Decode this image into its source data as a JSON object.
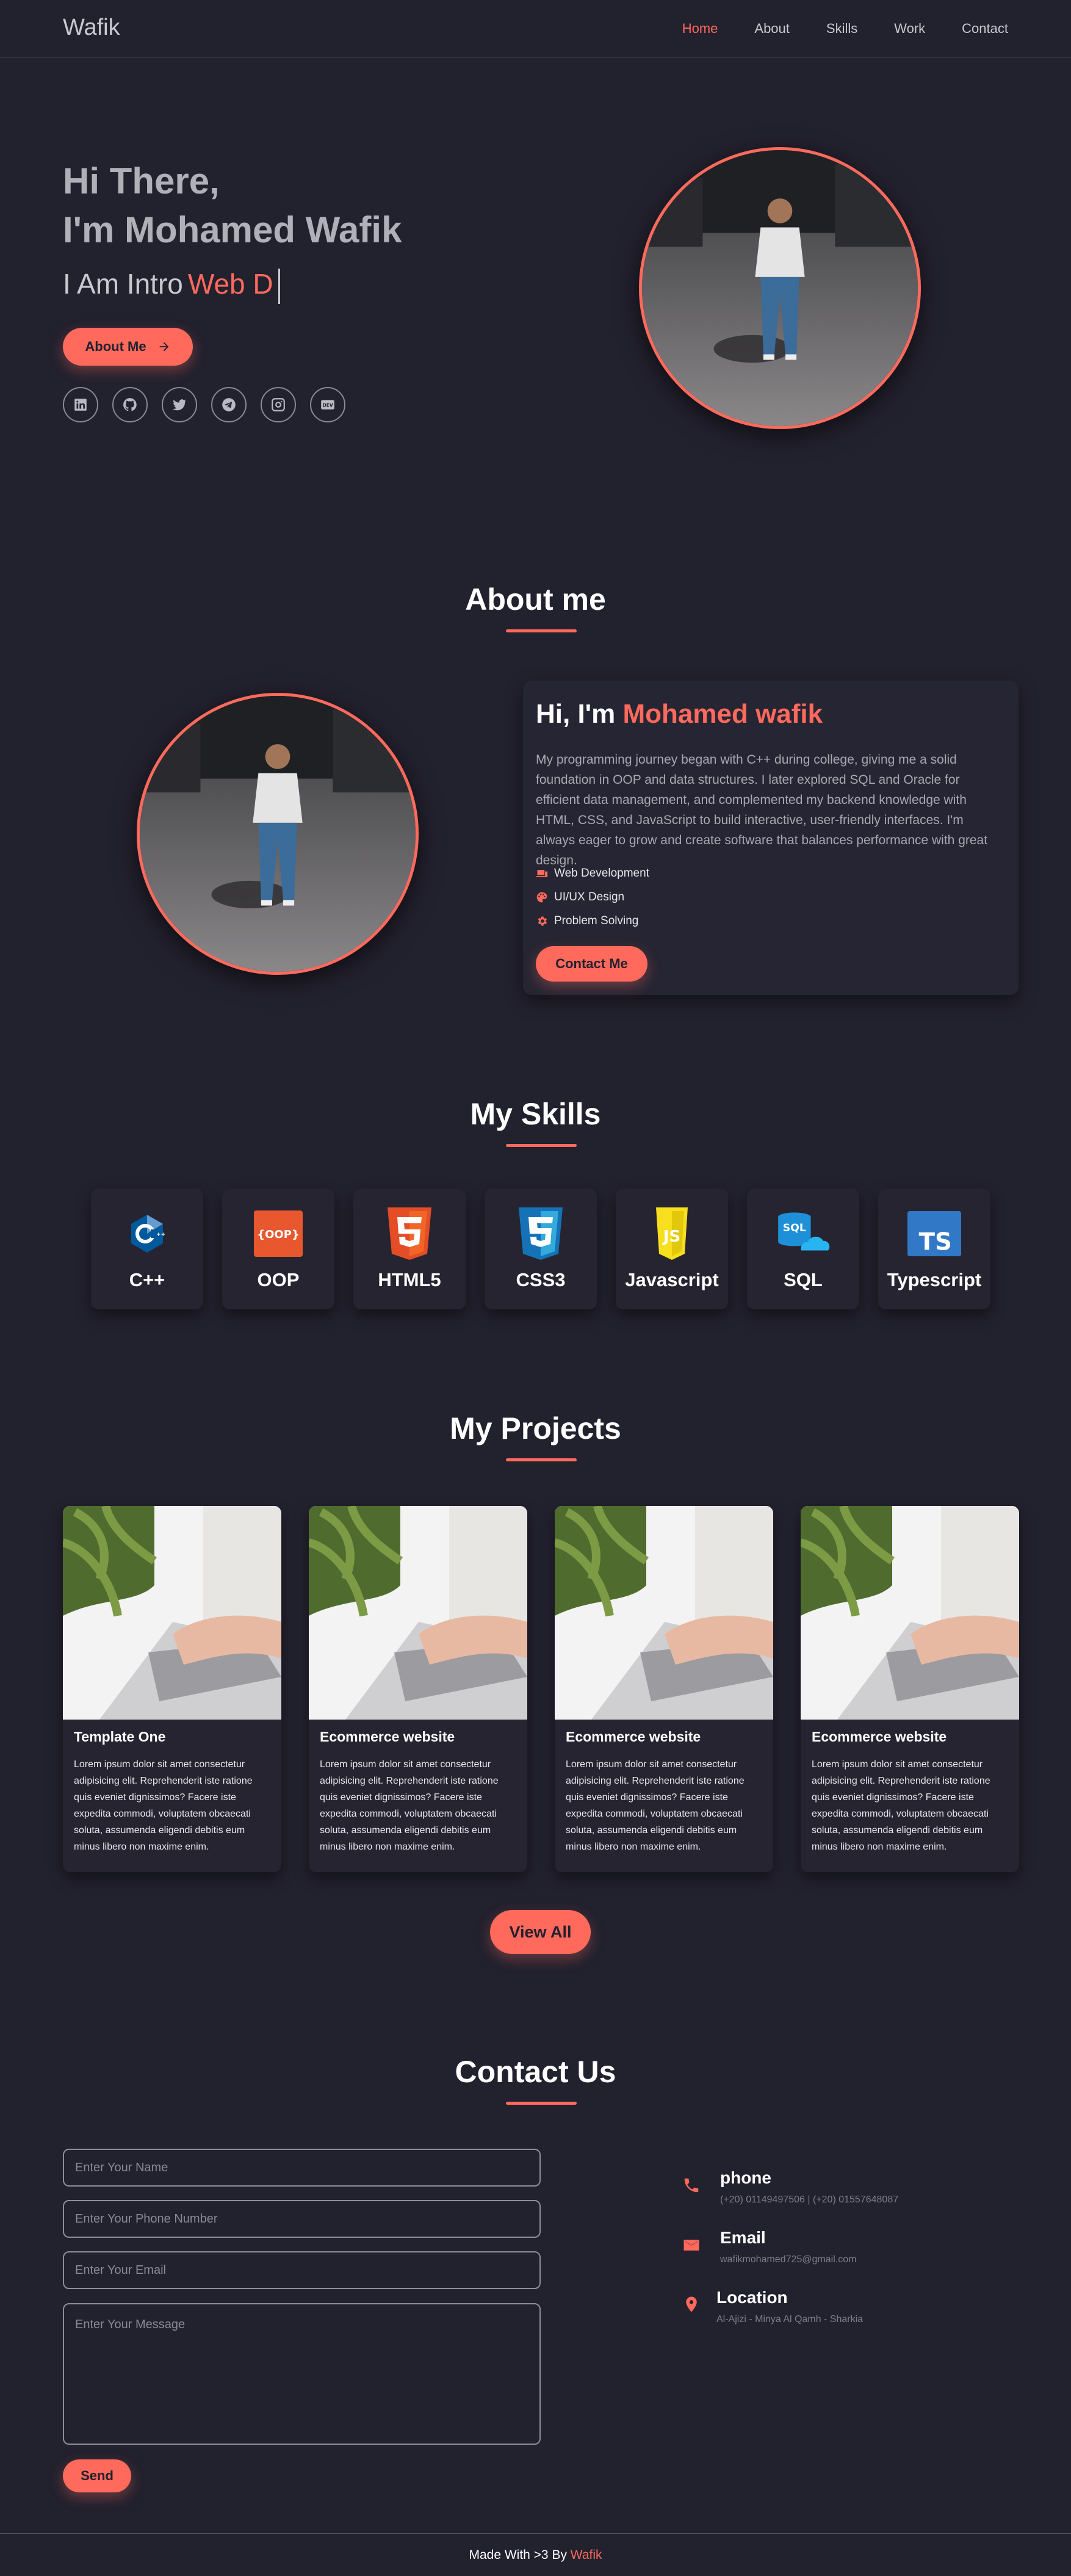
{
  "nav": {
    "brand": "Wafik",
    "items": [
      "Home",
      "About",
      "Skills",
      "Work",
      "Contact"
    ],
    "active": "Home"
  },
  "hero": {
    "line1": "Hi There,",
    "line2": "I'm Mohamed Wafik",
    "intro": "I Am Intro",
    "typed": "Web D",
    "button": "About Me",
    "socials": [
      "linkedin-icon",
      "github-icon",
      "twitter-icon",
      "telegram-icon",
      "instagram-icon",
      "dev-icon"
    ]
  },
  "about": {
    "title": "About me",
    "greeting": "Hi, I'm",
    "name": "Mohamed wafik",
    "text": "My programming journey began with C++ during college, giving me a solid foundation in OOP and data structures. I later explored SQL and Oracle for efficient data management, and complemented my backend knowledge with HTML, CSS, and JavaScript to build interactive, user-friendly interfaces. I'm always eager to grow and create software that balances performance with great design.",
    "bullets": [
      "Web Development",
      "UI/UX Design",
      "Problem Solving"
    ],
    "button": "Contact Me"
  },
  "skills": {
    "title": "My Skills",
    "items": [
      "C++",
      "OOP",
      "HTML5",
      "CSS3",
      "Javascript",
      "SQL",
      "Typescript"
    ],
    "logo_labels": {
      "oop": "{OOP}",
      "sql": "SQL",
      "ts": "TS",
      "js": "JS"
    }
  },
  "projects": {
    "title": "My Projects",
    "items": [
      {
        "title": "Template One",
        "desc": "Lorem ipsum dolor sit amet consectetur adipisicing elit. Reprehenderit iste ratione quis eveniet dignissimos? Facere iste expedita commodi, voluptatem obcaecati soluta, assumenda eligendi debitis eum minus libero non maxime enim."
      },
      {
        "title": "Ecommerce website",
        "desc": "Lorem ipsum dolor sit amet consectetur adipisicing elit. Reprehenderit iste ratione quis eveniet dignissimos? Facere iste expedita commodi, voluptatem obcaecati soluta, assumenda eligendi debitis eum minus libero non maxime enim."
      },
      {
        "title": "Ecommerce website",
        "desc": "Lorem ipsum dolor sit amet consectetur adipisicing elit. Reprehenderit iste ratione quis eveniet dignissimos? Facere iste expedita commodi, voluptatem obcaecati soluta, assumenda eligendi debitis eum minus libero non maxime enim."
      },
      {
        "title": "Ecommerce website",
        "desc": "Lorem ipsum dolor sit amet consectetur adipisicing elit. Reprehenderit iste ratione quis eveniet dignissimos? Facere iste expedita commodi, voluptatem obcaecati soluta, assumenda eligendi debitis eum minus libero non maxime enim."
      }
    ],
    "button": "View All"
  },
  "contact": {
    "title": "Contact Us",
    "placeholders": {
      "name": "Enter Your Name",
      "phone": "Enter Your Phone Number",
      "email": "Enter Your Email",
      "message": "Enter Your Message"
    },
    "send": "Send",
    "info": {
      "phone_title": "phone",
      "phone_value": "(+20) 01149497506 | (+20) 01557648087",
      "email_title": "Email",
      "email_value": "wafikmohamed725@gmail.com",
      "location_title": "Location",
      "location_value": "Al-Ajizi - Minya Al Qamh - Sharkia"
    }
  },
  "footer": {
    "text": "Made With >3 By",
    "name": "Wafik"
  },
  "colors": {
    "accent": "#ff6a5c",
    "background": "#22212e",
    "card": "#262533"
  }
}
